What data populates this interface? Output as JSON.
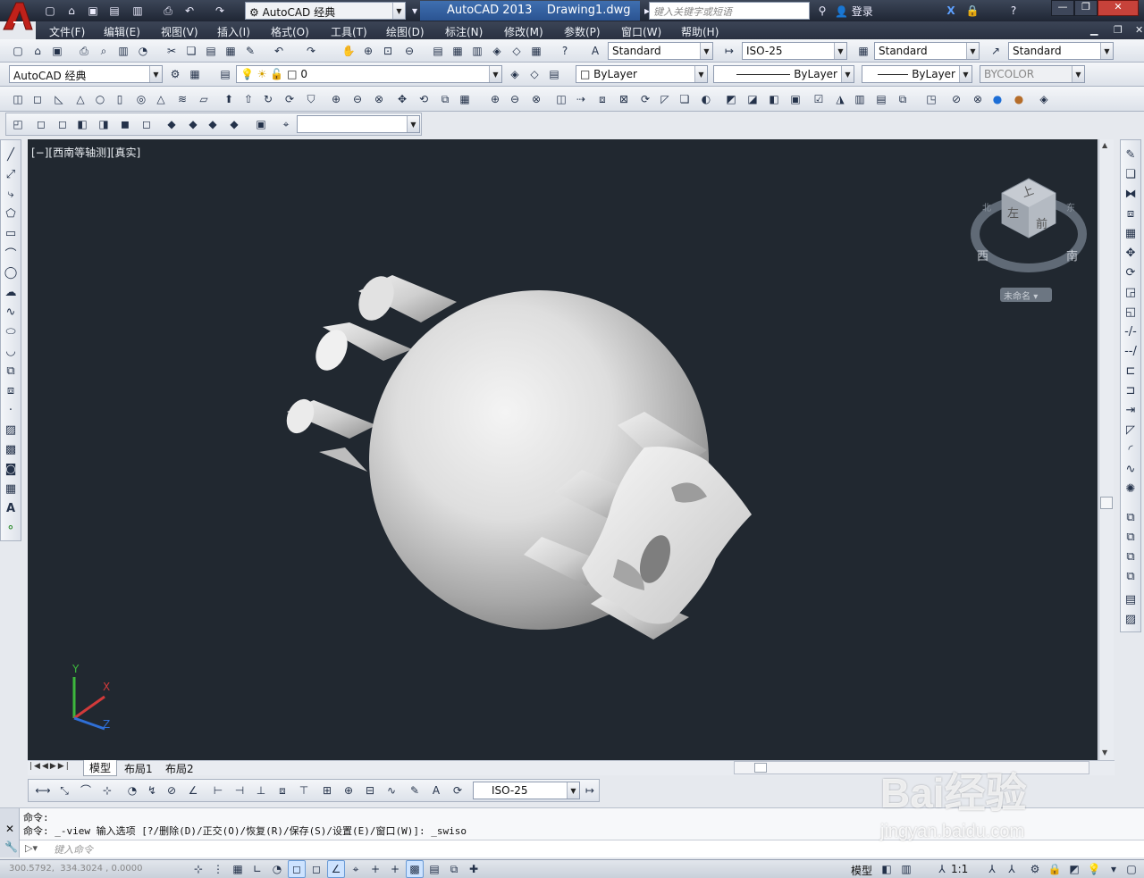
{
  "app": {
    "title": "AutoCAD 2013",
    "filename": "Drawing1.dwg",
    "workspace": "AutoCAD 经典",
    "search_placeholder": "键入关键字或短语",
    "login": "登录"
  },
  "menu": [
    "文件(F)",
    "编辑(E)",
    "视图(V)",
    "插入(I)",
    "格式(O)",
    "工具(T)",
    "绘图(D)",
    "标注(N)",
    "修改(M)",
    "参数(P)",
    "窗口(W)",
    "帮助(H)"
  ],
  "styles_toolbar": {
    "text_style": "Standard",
    "dim_style": "ISO-25",
    "table_style": "Standard",
    "multileader_style": "Standard"
  },
  "layers_toolbar": {
    "workspace": "AutoCAD 经典",
    "layer": "0",
    "color": "ByLayer",
    "linetype": "ByLayer",
    "lineweight": "ByLayer",
    "plotstyle": "BYCOLOR"
  },
  "viewport": {
    "label": "[−][西南等轴测][真实]",
    "viewcube": {
      "top": "上",
      "front": "前",
      "left": "左",
      "south": "南",
      "west": "西",
      "east": "东",
      "north": "北",
      "ucs_label": "未命名"
    },
    "ucs": {
      "x": "X",
      "y": "Y",
      "z": "Z"
    }
  },
  "tabs": [
    "模型",
    "布局1",
    "布局2"
  ],
  "dim_toolbar": {
    "dim_style": "ISO-25"
  },
  "command": {
    "history": [
      "命令:",
      "命令: _-view 输入选项 [?/删除(D)/正交(O)/恢复(R)/保存(S)/设置(E)/窗口(W)]: _swiso"
    ],
    "input_placeholder": "键入命令"
  },
  "status": {
    "coords": "300.5792,  334.3024 , 0.0000",
    "model": "模型",
    "scale": "1:1"
  },
  "watermark": {
    "brand": "Bai经验",
    "url": "jingyan.baidu.com"
  },
  "colors": {
    "viewport_bg": "#212830",
    "title_bg": "#2a3141",
    "accent_red": "#c0211a"
  }
}
